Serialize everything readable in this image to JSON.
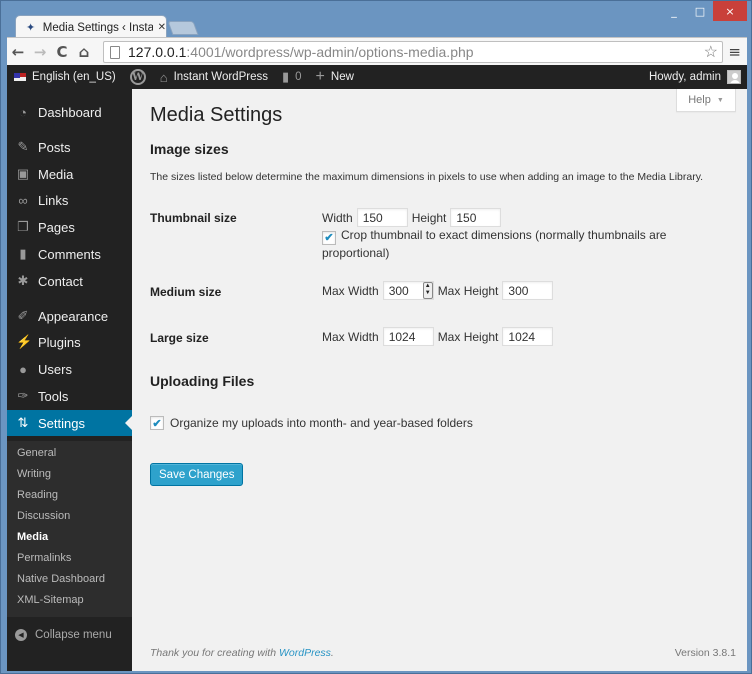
{
  "browser": {
    "tab_title": "Media Settings ‹ Instant W",
    "tab_favicon": "wordpress-runner-icon",
    "url_host": "127.0.0.1",
    "url_rest": ":4001/wordpress/wp-admin/options-media.php",
    "nav": {
      "back": "←",
      "forward": "→",
      "reload": "C",
      "home": "⌂"
    },
    "star": "☆",
    "menu": "≡",
    "window_controls": {
      "minimize": "_",
      "maximize": "□",
      "close": "×"
    }
  },
  "adminbar": {
    "language": "English (en_US)",
    "wp_logo": "W",
    "site_name": "Instant WordPress",
    "comments_count": "0",
    "new_label": "New",
    "greeting": "Howdy, admin"
  },
  "sidebar": {
    "items": [
      {
        "label": "Dashboard",
        "icon": "dashboard-icon",
        "glyph": "◔"
      },
      {
        "label": "Posts",
        "icon": "pushpin-icon",
        "glyph": "✎"
      },
      {
        "label": "Media",
        "icon": "media-icon",
        "glyph": "▣"
      },
      {
        "label": "Links",
        "icon": "link-icon",
        "glyph": "∞"
      },
      {
        "label": "Pages",
        "icon": "pages-icon",
        "glyph": "❐"
      },
      {
        "label": "Comments",
        "icon": "comment-icon",
        "glyph": "▮"
      },
      {
        "label": "Contact",
        "icon": "gear-icon",
        "glyph": "✱"
      },
      {
        "label": "Appearance",
        "icon": "paintbrush-icon",
        "glyph": "✐"
      },
      {
        "label": "Plugins",
        "icon": "plug-icon",
        "glyph": "⚡"
      },
      {
        "label": "Users",
        "icon": "user-icon",
        "glyph": "●"
      },
      {
        "label": "Tools",
        "icon": "wrench-icon",
        "glyph": "✑"
      },
      {
        "label": "Settings",
        "icon": "settings-icon",
        "glyph": "⇅"
      }
    ],
    "submenu": [
      "General",
      "Writing",
      "Reading",
      "Discussion",
      "Media",
      "Permalinks",
      "Native Dashboard",
      "XML-Sitemap"
    ],
    "current_submenu": "Media",
    "collapse_label": "Collapse menu"
  },
  "content": {
    "help_label": "Help",
    "title": "Media Settings",
    "image_sizes_heading": "Image sizes",
    "description": "The sizes listed below determine the maximum dimensions in pixels to use when adding an image to the Media Library.",
    "thumbnail": {
      "label": "Thumbnail size",
      "width_label": "Width",
      "width": "150",
      "height_label": "Height",
      "height": "150",
      "crop_checked": true,
      "crop_label": "Crop thumbnail to exact dimensions (normally thumbnails are proportional)"
    },
    "medium": {
      "label": "Medium size",
      "max_width_label": "Max Width",
      "max_width": "300",
      "max_height_label": "Max Height",
      "max_height": "300"
    },
    "large": {
      "label": "Large size",
      "max_width_label": "Max Width",
      "max_width": "1024",
      "max_height_label": "Max Height",
      "max_height": "1024"
    },
    "uploading_heading": "Uploading Files",
    "organize_checked": true,
    "organize_label": "Organize my uploads into month- and year-based folders",
    "save_label": "Save Changes"
  },
  "footer": {
    "thanks_prefix": "Thank you for creating with ",
    "thanks_link": "WordPress",
    "thanks_suffix": ".",
    "version": "Version 3.8.1"
  },
  "colors": {
    "accent": "#0074a2",
    "button": "#2ea2cc",
    "sidebar_bg": "#222222",
    "page_bg": "#f1f1f1"
  }
}
